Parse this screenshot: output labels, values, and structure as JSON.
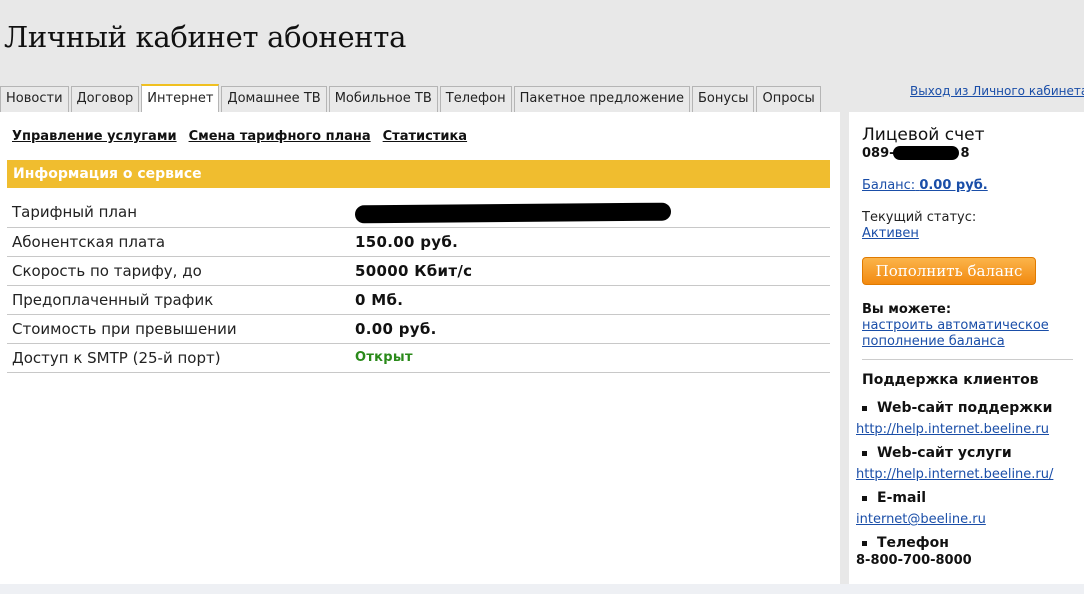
{
  "header": {
    "title": "Личный кабинет абонента"
  },
  "tabs": [
    {
      "label": "Новости",
      "active": false
    },
    {
      "label": "Договор",
      "active": false
    },
    {
      "label": "Интернет",
      "active": true
    },
    {
      "label": "Домашнее ТВ",
      "active": false
    },
    {
      "label": "Мобильное ТВ",
      "active": false
    },
    {
      "label": "Телефон",
      "active": false
    },
    {
      "label": "Пакетное предложение",
      "active": false
    },
    {
      "label": "Бонусы",
      "active": false
    },
    {
      "label": "Опросы",
      "active": false
    }
  ],
  "logout_link": "Выход из Личного кабинета",
  "subnav": [
    {
      "label": "Управление услугами"
    },
    {
      "label": "Смена тарифного плана"
    },
    {
      "label": "Статистика"
    }
  ],
  "service_info": {
    "header": "Информация о сервисе",
    "rows": [
      {
        "label": "Тарифный план",
        "value": ""
      },
      {
        "label": "Абонентская плата",
        "value": "150.00 руб."
      },
      {
        "label": "Скорость по тарифу, до",
        "value": "50000 Кбит/с"
      },
      {
        "label": "Предоплаченный трафик",
        "value": "0 Мб."
      },
      {
        "label": "Стоимость при превышении",
        "value": "0.00 руб."
      },
      {
        "label": "Доступ к SMTP (25-й порт)",
        "value": "Открыт"
      }
    ]
  },
  "sidebar": {
    "account_title": "Лицевой счет",
    "account_number_prefix": "089-",
    "account_number_suffix": "8",
    "balance_label": "Баланс:",
    "balance_value": "0.00 руб.",
    "status_label": "Текущий статус:",
    "status_value": "Активен",
    "topup_button": "Пополнить баланс",
    "can_label": "Вы можете:",
    "auto_topup_link": "настроить автоматическое пополнение баланса",
    "support": {
      "title": "Поддержка клиентов",
      "items": [
        {
          "label": "Web-сайт поддержки",
          "detail": "http://help.internet.beeline.ru"
        },
        {
          "label": "Web-сайт услуги",
          "detail": "http://help.internet.beeline.ru/"
        },
        {
          "label": "E-mail",
          "detail": "internet@beeline.ru"
        },
        {
          "label": "Телефон",
          "detail": "8-800-700-8000"
        }
      ]
    }
  },
  "colors": {
    "accent_yellow": "#f0bd2f",
    "button_orange": "#f28a10",
    "link_blue": "#1a4ea8",
    "status_green": "#2a8a1a"
  }
}
